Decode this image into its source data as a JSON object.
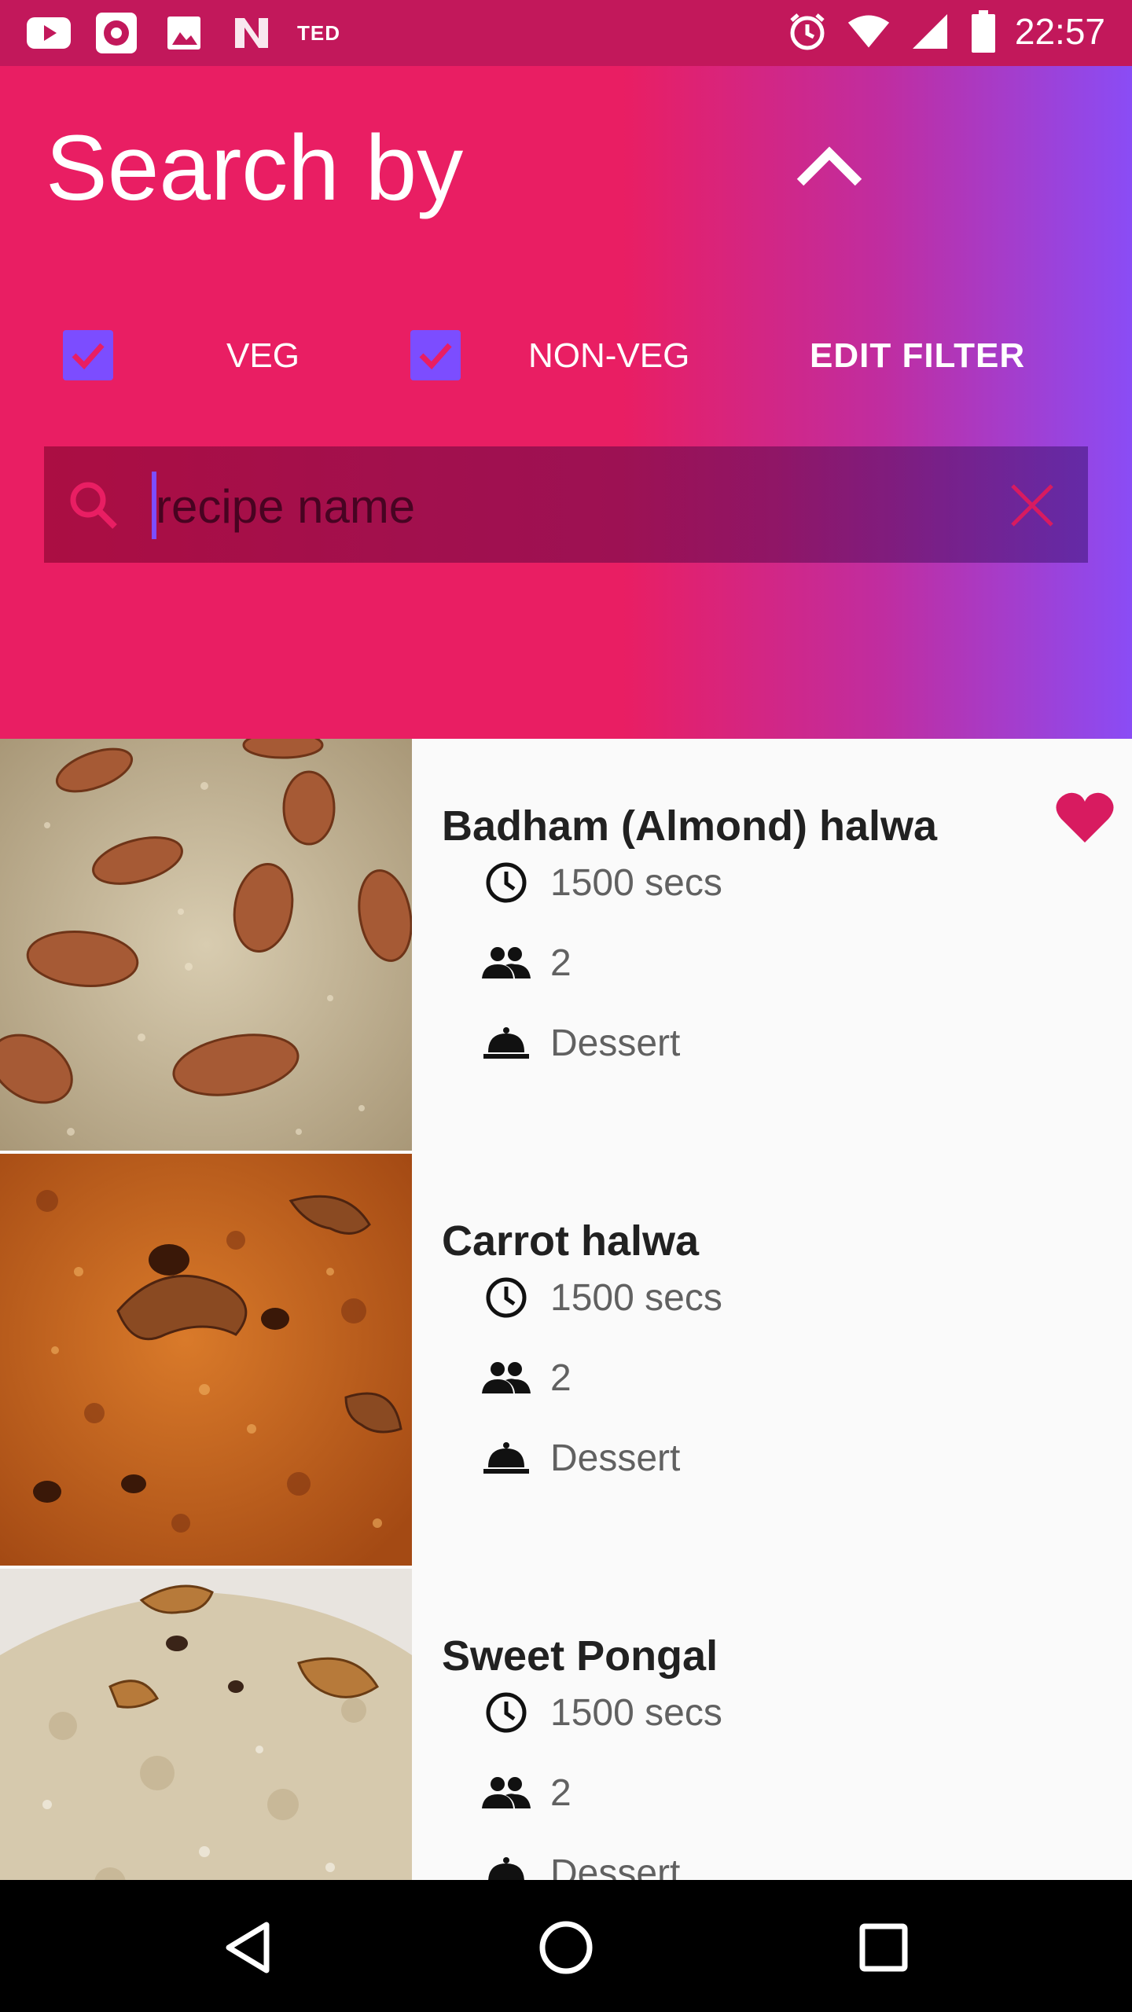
{
  "status_bar": {
    "carrier_label": "TED",
    "time": "22:57",
    "icons": [
      "youtube-icon",
      "app-icon",
      "image-icon",
      "n-icon",
      "alarm-icon",
      "wifi-icon",
      "signal-icon",
      "battery-icon"
    ]
  },
  "header": {
    "title": "Search by",
    "filters": {
      "veg_label": "VEG",
      "veg_checked": true,
      "nonveg_label": "NON-VEG",
      "nonveg_checked": true,
      "edit_label": "EDIT FILTER"
    },
    "search": {
      "placeholder": "recipe name",
      "value": ""
    },
    "gradient": [
      "#e91e63",
      "#8a4cf5"
    ],
    "accent": "#7c4dff"
  },
  "recipes": [
    {
      "name": "Badham (Almond) halwa",
      "time": "1500 secs",
      "servings": "2",
      "category": "Dessert",
      "favorite": true,
      "image": "almond-halwa"
    },
    {
      "name": "Carrot halwa",
      "time": "1500 secs",
      "servings": "2",
      "category": "Dessert",
      "favorite": false,
      "image": "carrot-halwa"
    },
    {
      "name": "Sweet Pongal",
      "time": "1500 secs",
      "servings": "2",
      "category": "Dessert",
      "favorite": false,
      "image": "sweet-pongal"
    }
  ],
  "colors": {
    "favorite": "#d81b60",
    "status_bar": "#c2185b"
  }
}
